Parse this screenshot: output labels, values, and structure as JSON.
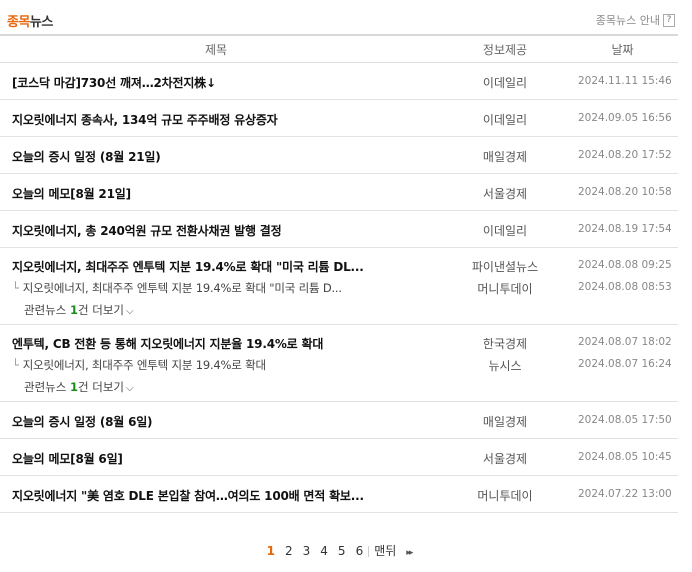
{
  "header": {
    "title_accent": "종목",
    "title_rest": "뉴스",
    "guide_label": "종목뉴스 안내",
    "help_label": "?"
  },
  "columns": {
    "title": "제목",
    "source": "정보제공",
    "date": "날짜"
  },
  "news": [
    {
      "title": "[코스닥 마감]730선 깨져…2차전지株↓",
      "source": "이데일리",
      "date": "2024.11.11 15:46"
    },
    {
      "title": "지오릿에너지 종속사, 134억 규모 주주배정 유상증자",
      "source": "이데일리",
      "date": "2024.09.05 16:56"
    },
    {
      "title": "오늘의 증시 일정 (8월 21일)",
      "source": "매일경제",
      "date": "2024.08.20 17:52"
    },
    {
      "title": "오늘의 메모[8월 21일]",
      "source": "서울경제",
      "date": "2024.08.20 10:58"
    },
    {
      "title": "지오릿에너지, 총 240억원 규모 전환사채권 발행 결정",
      "source": "이데일리",
      "date": "2024.08.19 17:54"
    },
    {
      "title": "지오릿에너지, 최대주주 엔투텍 지분 19.4%로 확대 \"미국 리튬 DL...",
      "source": "파이낸셜뉴스",
      "date": "2024.08.08 09:25",
      "related": {
        "title": "지오릿에너지, 최대주주 엔투텍 지분 19.4%로 확대 \"미국 리튬 D...",
        "source": "머니투데이",
        "date": "2024.08.08 08:53"
      },
      "more": {
        "prefix": "관련뉴스 ",
        "count": "1",
        "suffix": "건 더보기"
      }
    },
    {
      "title": "엔투텍, CB 전환 등 통해 지오릿에너지 지분율 19.4%로 확대",
      "source": "한국경제",
      "date": "2024.08.07 18:02",
      "related": {
        "title": "지오릿에너지, 최대주주 엔투텍 지분 19.4%로 확대",
        "source": "뉴시스",
        "date": "2024.08.07 16:24"
      },
      "more": {
        "prefix": "관련뉴스 ",
        "count": "1",
        "suffix": "건 더보기"
      }
    },
    {
      "title": "오늘의 증시 일정 (8월 6일)",
      "source": "매일경제",
      "date": "2024.08.05 17:50"
    },
    {
      "title": "오늘의 메모[8월 6일]",
      "source": "서울경제",
      "date": "2024.08.05 10:45"
    },
    {
      "title": "지오릿에너지 \"美 염호 DLE 본입찰 참여…여의도 100배 면적 확보...",
      "source": "머니투데이",
      "date": "2024.07.22 13:00"
    }
  ],
  "pager": {
    "pages": [
      "1",
      "2",
      "3",
      "4",
      "5",
      "6"
    ],
    "current": "1",
    "last_label": "맨뒤",
    "next_icon": "▸▸"
  },
  "colors": {
    "accent": "#e8670b",
    "count": "#1a8c1a"
  }
}
